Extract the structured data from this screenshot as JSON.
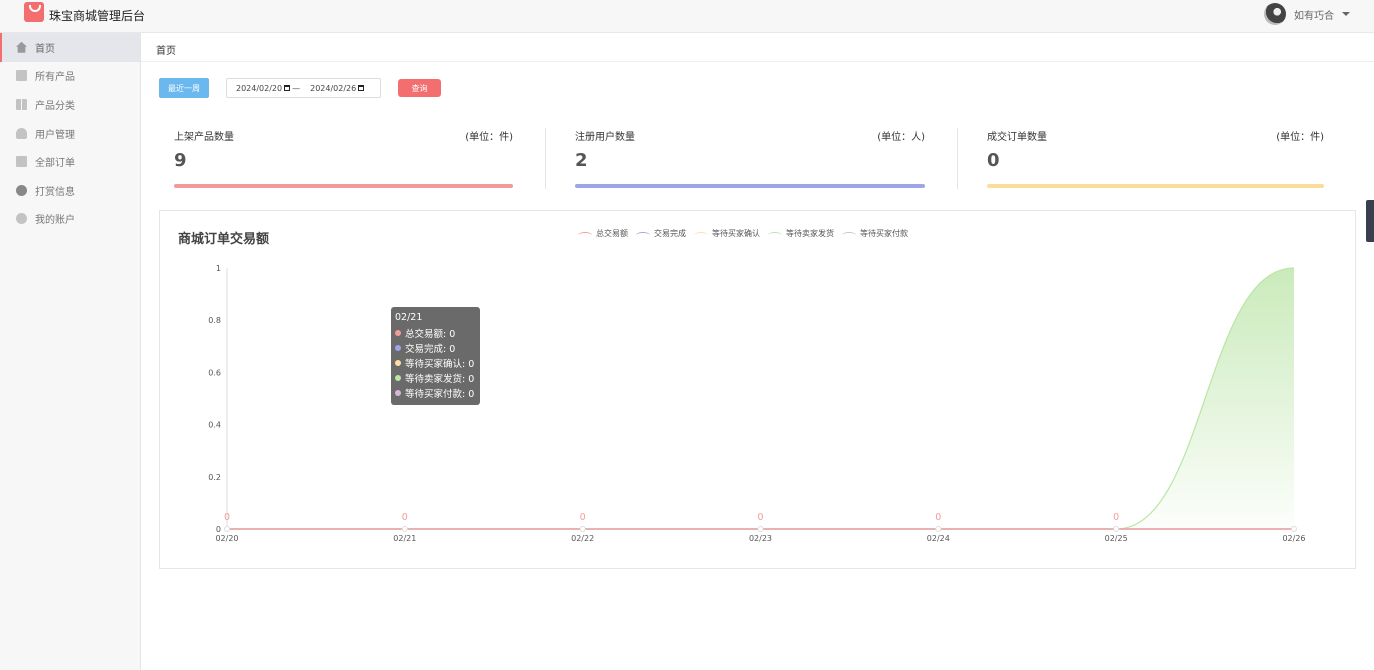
{
  "app": {
    "title": "珠宝商城管理后台"
  },
  "user": {
    "name": "如有巧合"
  },
  "sidebar": {
    "items": [
      {
        "label": "首页",
        "icon": "home-icon",
        "active": true
      },
      {
        "label": "所有产品",
        "icon": "product-icon"
      },
      {
        "label": "产品分类",
        "icon": "category-icon"
      },
      {
        "label": "用户管理",
        "icon": "user-icon"
      },
      {
        "label": "全部订单",
        "icon": "order-icon"
      },
      {
        "label": "打赏信息",
        "icon": "reward-icon"
      },
      {
        "label": "我的账户",
        "icon": "settings-icon"
      }
    ]
  },
  "breadcrumb": "首页",
  "filter": {
    "recent_week_label": "最近一周",
    "start_date": "2024/02/20",
    "separator": "—",
    "end_date": "2024/02/26",
    "query_label": "查询"
  },
  "stats": [
    {
      "label": "上架产品数量",
      "unit": "(单位：件)",
      "value": "9",
      "color": "#f09a9a"
    },
    {
      "label": "注册用户数量",
      "unit": "(单位：人)",
      "value": "2",
      "color": "#9ea5e6"
    },
    {
      "label": "成交订单数量",
      "unit": "(单位：件)",
      "value": "0",
      "color": "#fbdc9a"
    }
  ],
  "chart_data": {
    "type": "line",
    "title": "商城订单交易额",
    "x": [
      "02/20",
      "02/21",
      "02/22",
      "02/23",
      "02/24",
      "02/25",
      "02/26"
    ],
    "y_ticks": [
      "0",
      "0.2",
      "0.4",
      "0.6",
      "0.8",
      "1"
    ],
    "ylim": [
      0,
      1
    ],
    "series": [
      {
        "name": "总交易额",
        "color": "#f19c9c",
        "values": [
          0,
          0,
          0,
          0,
          0,
          0,
          0
        ],
        "labels": [
          "0",
          "0",
          "0",
          "0",
          "0",
          "0"
        ]
      },
      {
        "name": "交易完成",
        "color": "#9ea5e6",
        "values": [
          0,
          0,
          0,
          0,
          0,
          0,
          0
        ]
      },
      {
        "name": "等待买家确认",
        "color": "#fbe19c",
        "values": [
          0,
          0,
          0,
          0,
          0,
          0,
          0
        ]
      },
      {
        "name": "等待卖家发货",
        "color": "#b8e6a5",
        "values": [
          0,
          0,
          0,
          0,
          0,
          0,
          1
        ]
      },
      {
        "name": "等待买家付款",
        "color": "#d9b6d9",
        "values": [
          0,
          0,
          0,
          0,
          0,
          0,
          0
        ]
      }
    ],
    "legend_position": "top-center"
  },
  "tooltip": {
    "title": "02/21",
    "rows": [
      {
        "text": "总交易额: 0",
        "color": "#f19c9c"
      },
      {
        "text": "交易完成: 0",
        "color": "#9ea5e6"
      },
      {
        "text": "等待买家确认: 0",
        "color": "#fbe19c"
      },
      {
        "text": "等待卖家发货: 0",
        "color": "#b8e6a5"
      },
      {
        "text": "等待买家付款: 0",
        "color": "#d9b6d9"
      }
    ]
  }
}
